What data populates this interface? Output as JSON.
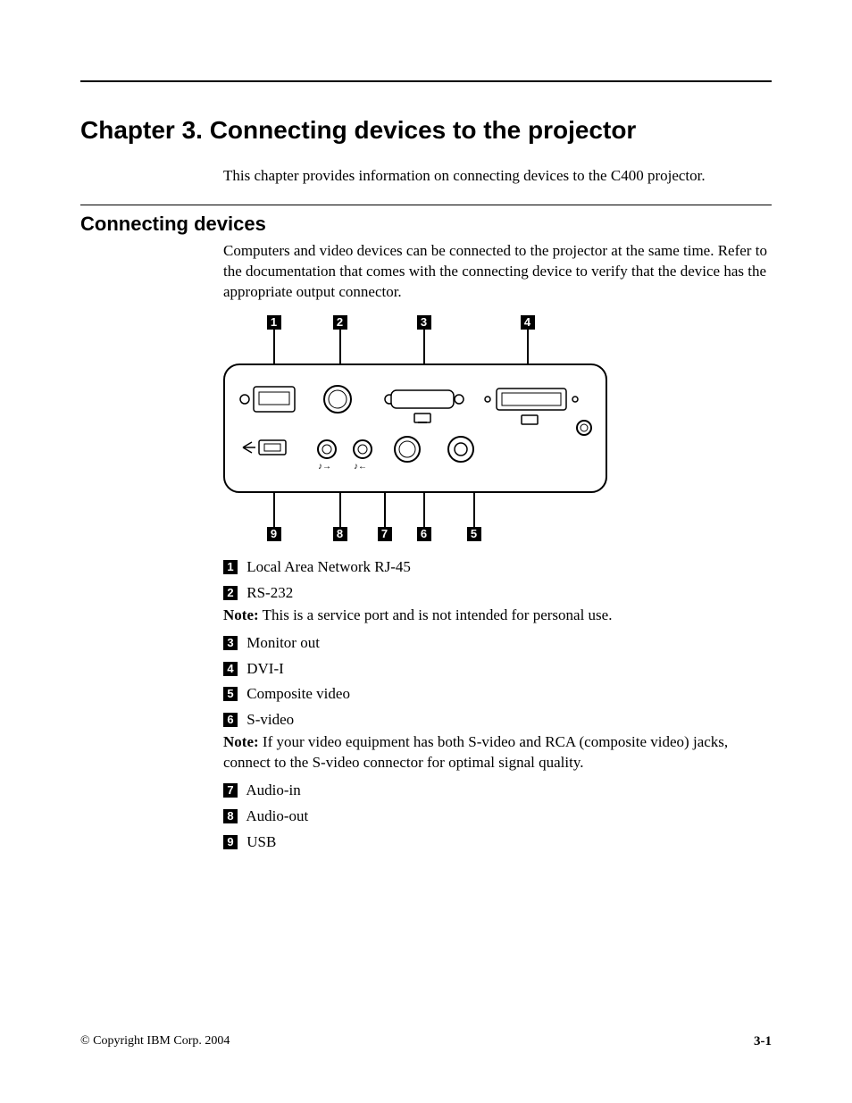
{
  "chapter": {
    "title": "Chapter 3. Connecting devices to the projector",
    "intro": "This chapter provides information on connecting devices to the C400 projector."
  },
  "section": {
    "title": "Connecting devices",
    "body": "Computers and video devices can be connected to the projector at the same time. Refer to the documentation that comes with the connecting device to verify that the device has the appropriate output connector."
  },
  "diagram": {
    "top_labels": [
      "1",
      "2",
      "3",
      "4"
    ],
    "bottom_labels": [
      "9",
      "8",
      "7",
      "6",
      "5"
    ]
  },
  "callouts": [
    {
      "num": "1",
      "label": "Local Area Network RJ-45"
    },
    {
      "num": "2",
      "label": "RS-232",
      "note": "This is a service port and is not intended for personal use."
    },
    {
      "num": "3",
      "label": "Monitor out"
    },
    {
      "num": "4",
      "label": "DVI-I"
    },
    {
      "num": "5",
      "label": "Composite video"
    },
    {
      "num": "6",
      "label": "S-video",
      "note": "If your video equipment has both S-video and RCA (composite video) jacks, connect to the S-video connector for optimal signal quality."
    },
    {
      "num": "7",
      "label": "Audio-in"
    },
    {
      "num": "8",
      "label": "Audio-out"
    },
    {
      "num": "9",
      "label": "USB"
    }
  ],
  "note_label": "Note:",
  "footer": {
    "copyright": "© Copyright IBM Corp. 2004",
    "page": "3-1"
  }
}
